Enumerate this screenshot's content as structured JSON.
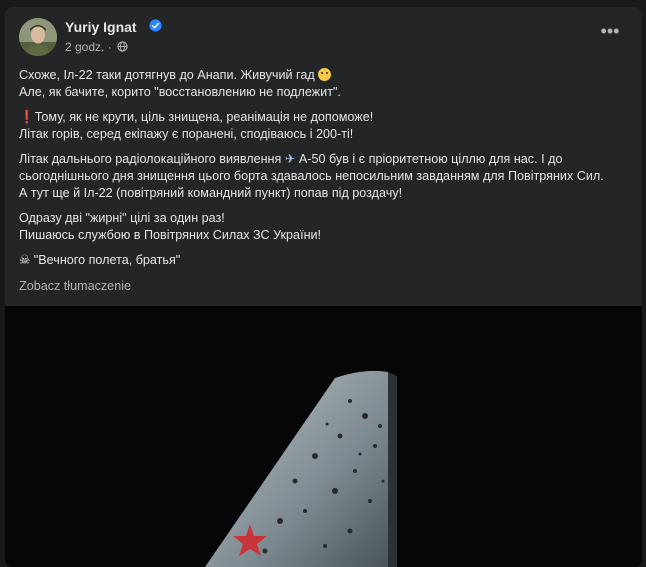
{
  "post": {
    "author": "Yuriy Ignat",
    "time": "2 godz.",
    "separator": "·",
    "more_label": "•••",
    "paragraphs": [
      {
        "lines": [
          {
            "text": "Схоже, Іл-22 таки дотягнув до Анапи. Живучий гад ",
            "emoji": "face-icon"
          },
          {
            "text": "Але, як бачите, корито \"восстановлению не подлежит\"."
          }
        ]
      },
      {
        "lines": [
          {
            "prefix": "❗",
            "text": "Тому, як не крути, ціль знищена, реанімація не допоможе!"
          },
          {
            "text": "Літак горів, серед екіпажу є поранені, сподіваюсь і 200-ті!"
          }
        ]
      },
      {
        "lines": [
          {
            "text": "Літак дальнього радіолокаційного виявлення ",
            "plane": "✈",
            "text2": " А-50 був і є пріоритетною ціллю для нас. І до"
          },
          {
            "text": "сьогоднішнього дня знищення цього борта здавалось непосильним завданням для Повітряних Сил."
          },
          {
            "text": "А тут ще й Іл-22 (повітряний командний пункт) попав під роздачу!"
          }
        ]
      },
      {
        "lines": [
          {
            "text": "Одразу дві \"жирні\" цілі за один раз!"
          },
          {
            "text": "Пишаюсь службою в Повітряних Силах ЗС України!"
          }
        ]
      },
      {
        "lines": [
          {
            "prefix": "☠",
            "text": " \"Вечного полета, братья\""
          }
        ]
      }
    ],
    "translate_label": "Zobacz tłumaczenie"
  },
  "colors": {
    "card_bg": "#242526",
    "page_bg": "#18191a",
    "text_primary": "#e4e6eb",
    "text_secondary": "#b0b3b8",
    "verified": "#2d88ff"
  }
}
